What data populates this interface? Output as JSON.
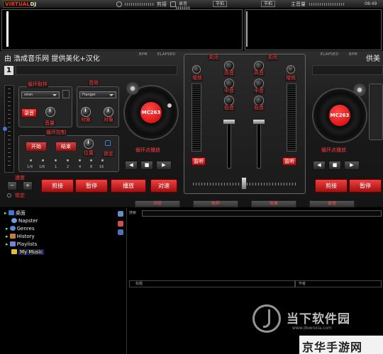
{
  "topbar": {
    "logo": "VIRTUAL",
    "logo_dj": "DJ",
    "label_preview": "剪接",
    "label_record": "录音",
    "label_sync": "节拍",
    "label_sync2": "节拍",
    "label_master": "主音量",
    "time": "08:49"
  },
  "deck_left": {
    "title": "由 浩成音乐网 提供美化+汉化",
    "bpm_label": "BPM",
    "elapsed_label": "ELAPSED",
    "number": "1",
    "loop_sampler": "循环取样",
    "sampler_select": "siren",
    "record_btn": "录音",
    "volume_label": "音量",
    "effects": "音效",
    "effect_select": "Flanger",
    "param1": "对象",
    "param2": "对象",
    "loop_control": "循环控制",
    "start_btn": "开始",
    "end_btn": "结束",
    "position_label": "位置",
    "lock_label": "锁定",
    "loop_sizes": [
      "1/4",
      "1/8",
      "1",
      "2",
      "4",
      "8",
      "16"
    ],
    "loop_play": "循环点播放",
    "speed": "速度",
    "lock_bottom": "锁定",
    "cue_btn": "剪接",
    "pause_btn": "暂停",
    "play_btn": "播放",
    "sync_btn": "对速",
    "disc_label": "MC263",
    "minus": "−",
    "plus": "+"
  },
  "mixer": {
    "close_left": "关闭",
    "close_right": "关闭",
    "gain": "增效",
    "gain_right": "增效",
    "high_left": "高音",
    "high_right": "高音",
    "mid_left": "中音",
    "mid_right": "中音",
    "low_left": "低音",
    "low_right": "低音",
    "monitor_left": "监听",
    "monitor_right": "监听"
  },
  "deck_right": {
    "title": "供美",
    "bpm_label": "BPM",
    "elapsed_label": "ELAPSED",
    "loop_play": "循环点播放",
    "cue_btn": "剪接",
    "pause_btn": "暂停",
    "disc_label": "MC263"
  },
  "tabs": [
    "浏览",
    "取样",
    "效果",
    "录音"
  ],
  "browser": {
    "search_label": "搜索",
    "tree": [
      {
        "label": "桌面",
        "color": "#3a7bd5"
      },
      {
        "label": "Napster",
        "color": "#6aa0e0"
      },
      {
        "label": "Genres",
        "color": "#5a8ad0"
      },
      {
        "label": "History",
        "color": "#c08040"
      },
      {
        "label": "Playlists",
        "color": "#8080d0"
      },
      {
        "label": "My Music",
        "color": "#e0c030"
      }
    ],
    "col_title": "标题",
    "col_artist": "作者"
  },
  "watermark": {
    "brand": "当下软件园",
    "url": "www.downxia.com",
    "site": "京华手游网"
  }
}
